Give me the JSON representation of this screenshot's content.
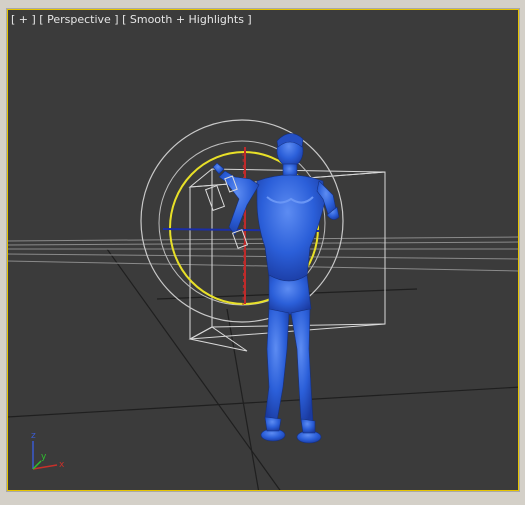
{
  "viewport": {
    "menu_label": "[ + ]",
    "view_label": "[ Perspective ]",
    "shading_label": "[ Smooth + Highlights ]"
  },
  "axis_tripod": {
    "x_label": "x",
    "y_label": "y",
    "z_label": "z",
    "x_color": "#c8302a",
    "y_color": "#2fbf2f",
    "z_color": "#3a5bd0"
  },
  "colors": {
    "model": "#2b5fd9",
    "active_border": "#e6c400",
    "gizmo_yellow": "#e8e028",
    "gizmo_white": "#dcdcdc"
  }
}
